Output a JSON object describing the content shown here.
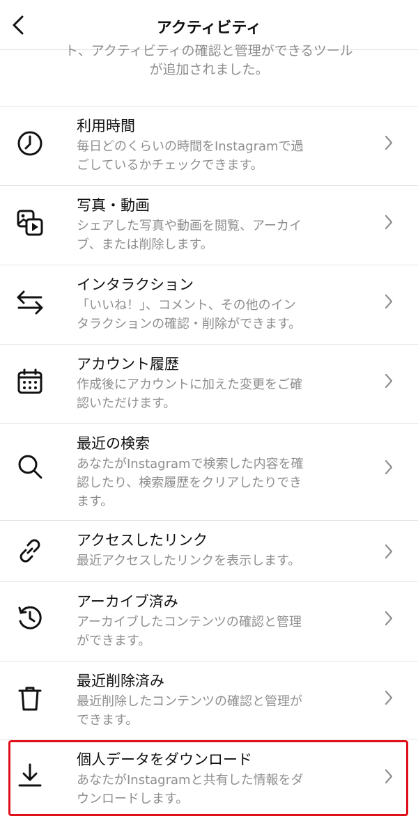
{
  "header": {
    "title": "アクティビティ",
    "back_icon": "chevron-left-icon"
  },
  "intro": {
    "line1": "ト、アクティビティの確認と管理ができるツール",
    "line2": "が追加されました。"
  },
  "items": [
    {
      "icon": "clock-icon",
      "title": "利用時間",
      "desc1": "毎日どのくらいの時間をInstagramで過",
      "desc2": "ごしているかチェックできます。"
    },
    {
      "icon": "photo-video-icon",
      "title": "写真・動画",
      "desc1": "シェアした写真や動画を閲覧、アーカイ",
      "desc2": "ブ、または削除します。"
    },
    {
      "icon": "arrows-swap-icon",
      "title": "インタラクション",
      "desc1": "「いいね！」、コメント、その他のイン",
      "desc2": "タラクションの確認・削除ができます。"
    },
    {
      "icon": "calendar-icon",
      "title": "アカウント履歴",
      "desc1": "作成後にアカウントに加えた変更をご確",
      "desc2": "認いただけます。"
    },
    {
      "icon": "search-icon",
      "title": "最近の検索",
      "desc1": "あなたがInstagramで検索した内容を確",
      "desc2": "認したり、検索履歴をクリアしたりでき",
      "desc3": "ます。"
    },
    {
      "icon": "link-icon",
      "title": "アクセスしたリンク",
      "desc1": "最近アクセスしたリンクを表示します。"
    },
    {
      "icon": "archive-history-icon",
      "title": "アーカイブ済み",
      "desc1": "アーカイブしたコンテンツの確認と管理",
      "desc2": "ができます。"
    },
    {
      "icon": "trash-icon",
      "title": "最近削除済み",
      "desc1": "最近削除したコンテンツの確認と管理が",
      "desc2": "できます。"
    },
    {
      "icon": "download-icon",
      "title": "個人データをダウンロード",
      "desc1": "あなたがInstagramと共有した情報をダ",
      "desc2": "ウンロードします。"
    }
  ],
  "colors": {
    "text": "#111111",
    "secondary": "#8e8e8e",
    "divider": "#e6e6e6",
    "highlight": "#e0101b"
  }
}
